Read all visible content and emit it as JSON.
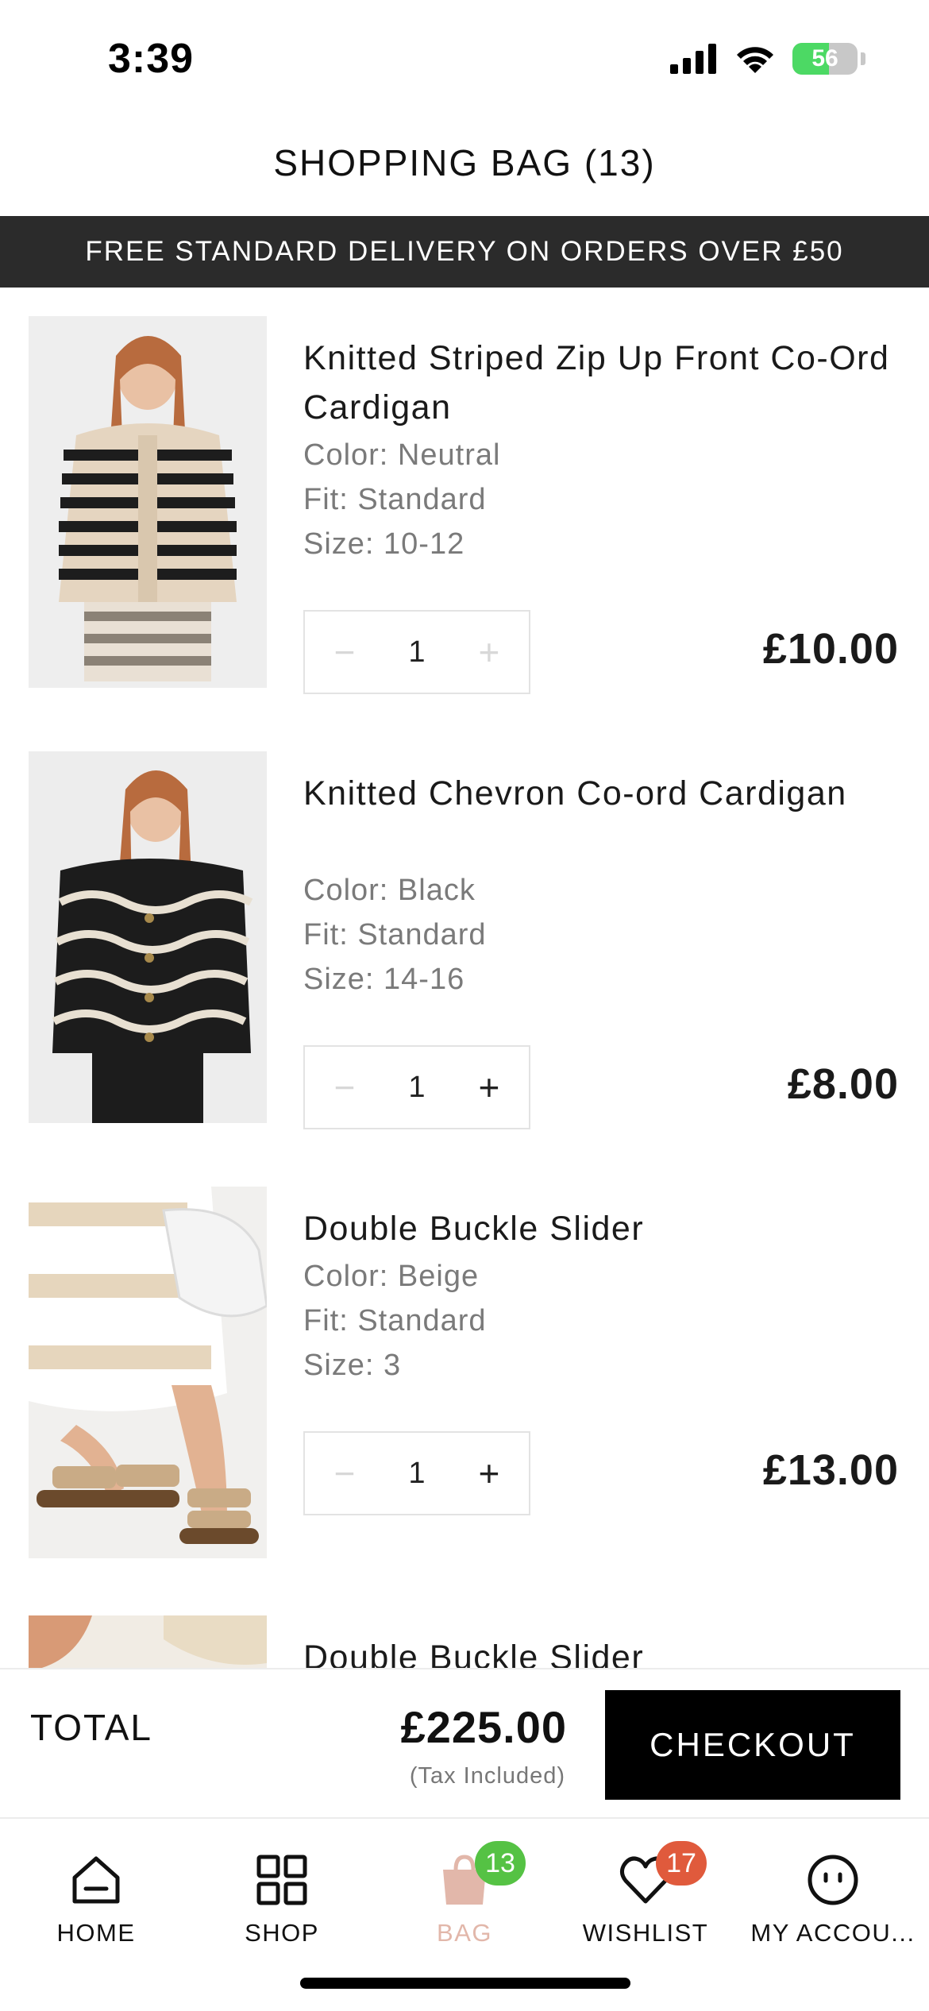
{
  "status_bar": {
    "time": "3:39",
    "battery_level": "56",
    "battery_percent": 56,
    "icons": [
      "signal-icon",
      "wifi-icon",
      "battery-icon"
    ]
  },
  "header": {
    "title": "SHOPPING BAG (13)"
  },
  "promo_banner": {
    "text": "FREE STANDARD DELIVERY ON ORDERS OVER £50"
  },
  "items": [
    {
      "title": "Knitted Striped Zip Up Front Co-Ord Cardigan",
      "color": "Color: Neutral",
      "fit": "Fit: Standard",
      "size": "Size: 10-12",
      "qty_minus": "−",
      "quantity": "1",
      "qty_plus": "+",
      "price": "£10.00"
    },
    {
      "title": "Knitted Chevron Co-ord Cardigan",
      "color": "Color: Black",
      "fit": "Fit: Standard",
      "size": "Size: 14-16",
      "qty_minus": "−",
      "quantity": "1",
      "qty_plus": "+",
      "price": "£8.00"
    },
    {
      "title": "Double Buckle Slider",
      "color": "Color: Beige",
      "fit": "Fit: Standard",
      "size": "Size: 3",
      "qty_minus": "−",
      "quantity": "1",
      "qty_plus": "+",
      "price": "£13.00"
    },
    {
      "title": "Double Buckle Slider"
    }
  ],
  "totals": {
    "label": "TOTAL",
    "amount": "£225.00",
    "tax_note": "(Tax Included)",
    "checkout_label": "CHECKOUT"
  },
  "tab_bar": {
    "tabs": [
      {
        "label": "HOME",
        "icon": "home-icon"
      },
      {
        "label": "SHOP",
        "icon": "grid-icon"
      },
      {
        "label": "BAG",
        "icon": "bag-icon",
        "badge": "13"
      },
      {
        "label": "WISHLIST",
        "icon": "heart-icon",
        "badge": "17"
      },
      {
        "label": "MY ACCOU...",
        "icon": "account-icon"
      }
    ],
    "active_color": "#e2b7aa"
  },
  "colors": {
    "banner_bg": "#2b2b2b",
    "checkout_bg": "#000000",
    "bag_badge": "#55c244",
    "wishlist_badge": "#e05a3c",
    "battery_green": "#4cd964"
  }
}
